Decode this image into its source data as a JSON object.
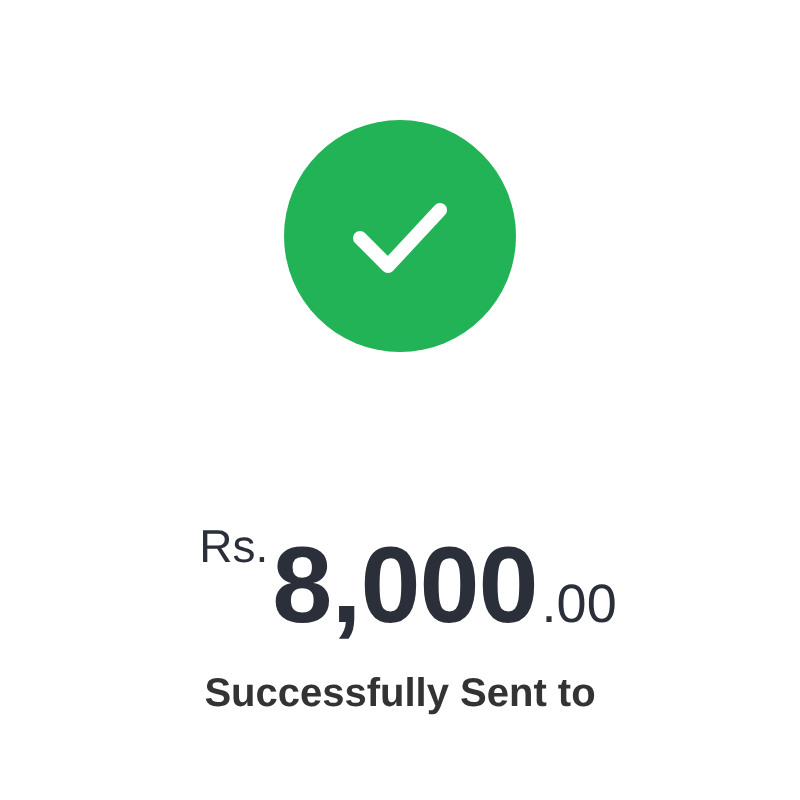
{
  "status": {
    "success": true
  },
  "amount": {
    "currency": "Rs.",
    "whole": "8,000",
    "fraction": ".00"
  },
  "message": "Successfully Sent to"
}
